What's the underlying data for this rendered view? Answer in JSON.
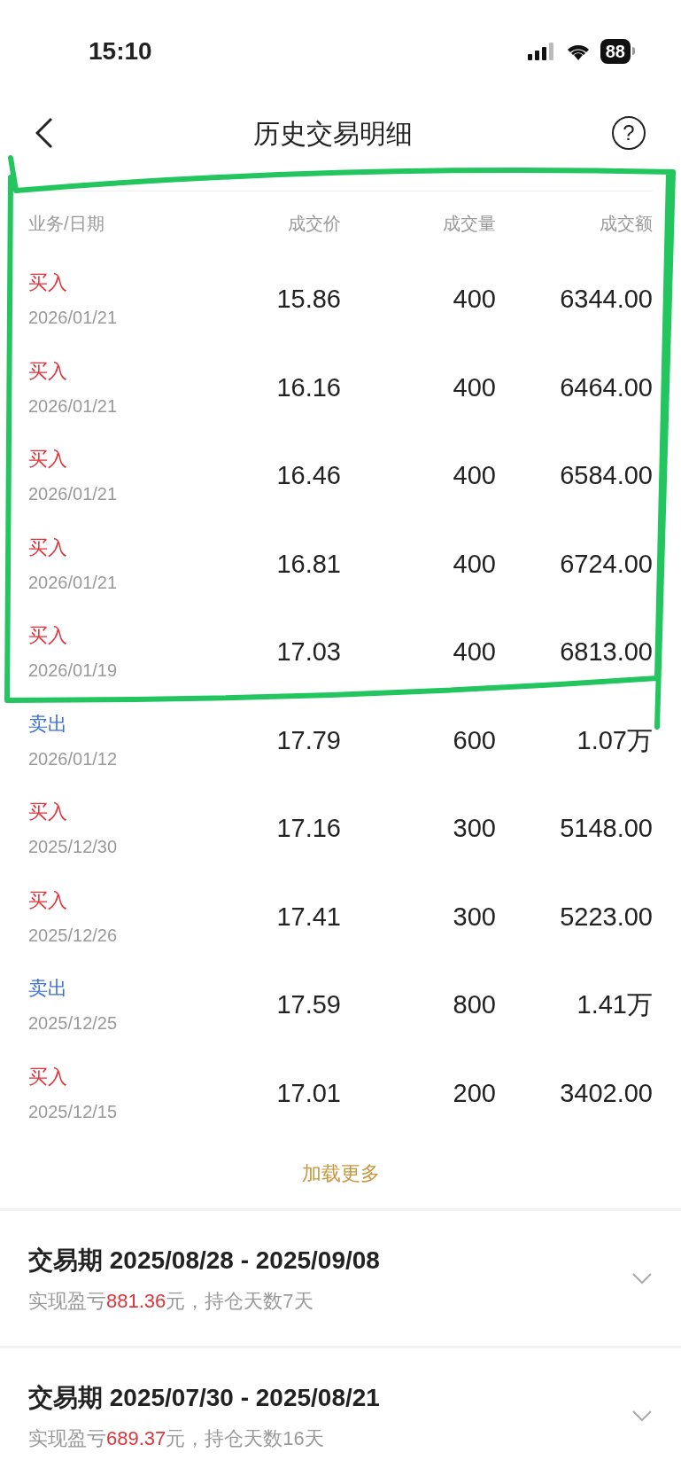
{
  "status_bar": {
    "time": "15:10",
    "battery": "88"
  },
  "header": {
    "title": "历史交易明细",
    "help": "?"
  },
  "table": {
    "columns": [
      "业务/日期",
      "成交价",
      "成交量",
      "成交额"
    ],
    "rows": [
      {
        "kind": "buy",
        "type": "买入",
        "date": "2026/01/21",
        "price": "15.86",
        "volume": "400",
        "amount": "6344.00"
      },
      {
        "kind": "buy",
        "type": "买入",
        "date": "2026/01/21",
        "price": "16.16",
        "volume": "400",
        "amount": "6464.00"
      },
      {
        "kind": "buy",
        "type": "买入",
        "date": "2026/01/21",
        "price": "16.46",
        "volume": "400",
        "amount": "6584.00"
      },
      {
        "kind": "buy",
        "type": "买入",
        "date": "2026/01/21",
        "price": "16.81",
        "volume": "400",
        "amount": "6724.00"
      },
      {
        "kind": "buy",
        "type": "买入",
        "date": "2026/01/19",
        "price": "17.03",
        "volume": "400",
        "amount": "6813.00"
      },
      {
        "kind": "sell",
        "type": "卖出",
        "date": "2026/01/12",
        "price": "17.79",
        "volume": "600",
        "amount": "1.07万"
      },
      {
        "kind": "buy",
        "type": "买入",
        "date": "2025/12/30",
        "price": "17.16",
        "volume": "300",
        "amount": "5148.00"
      },
      {
        "kind": "buy",
        "type": "买入",
        "date": "2025/12/26",
        "price": "17.41",
        "volume": "300",
        "amount": "5223.00"
      },
      {
        "kind": "sell",
        "type": "卖出",
        "date": "2025/12/25",
        "price": "17.59",
        "volume": "800",
        "amount": "1.41万"
      },
      {
        "kind": "buy",
        "type": "买入",
        "date": "2025/12/15",
        "price": "17.01",
        "volume": "200",
        "amount": "3402.00"
      }
    ]
  },
  "load_more": "加载更多",
  "periods": [
    {
      "title": "交易期 2025/08/28 - 2025/09/08",
      "summary_before": "实现盈亏",
      "profit": "881.36",
      "summary_after": "元，持仓天数7天",
      "expanded": false
    },
    {
      "title": "交易期 2025/07/30 - 2025/08/21",
      "summary_before": "实现盈亏",
      "profit": "689.37",
      "summary_after": "元，持仓天数16天",
      "expanded": false
    }
  ]
}
